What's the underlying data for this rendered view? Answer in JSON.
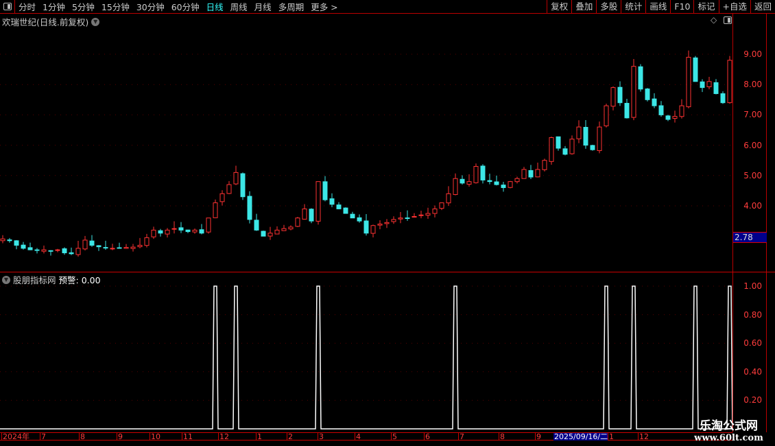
{
  "toolbar": {
    "periods": [
      {
        "label": "分时"
      },
      {
        "label": "1分钟"
      },
      {
        "label": "5分钟"
      },
      {
        "label": "15分钟"
      },
      {
        "label": "30分钟"
      },
      {
        "label": "60分钟"
      },
      {
        "label": "日线",
        "active": true
      },
      {
        "label": "周线"
      },
      {
        "label": "月线"
      },
      {
        "label": "多周期"
      },
      {
        "label": "更多 >"
      }
    ],
    "right_buttons": [
      "复权",
      "叠加",
      "多股",
      "统计",
      "画线",
      "F10",
      "标记",
      "+自选",
      "返回"
    ]
  },
  "stock_title": "欢瑞世纪(日线.前复权)",
  "indicator": {
    "name": "股朋指标网",
    "label": "预警: 0.00"
  },
  "current_price_label": "2.78",
  "watermark": {
    "line1": "乐淘公式网",
    "line2": "www.60lt.com"
  },
  "colors": {
    "up": "#ff3232",
    "down": "#3ce6e6",
    "axis": "#cc0000",
    "signal": "#ffffff"
  },
  "chart_data": [
    {
      "type": "candlestick",
      "y_ticks": [
        "9.00",
        "8.00",
        "7.00",
        "6.00",
        "5.00",
        "4.00"
      ],
      "ylim": [
        2.3,
        9.6
      ],
      "closes": [
        2.91,
        2.85,
        2.7,
        2.6,
        2.55,
        2.53,
        2.55,
        2.5,
        2.55,
        2.45,
        2.42,
        2.6,
        2.87,
        2.7,
        2.65,
        2.62,
        2.6,
        2.62,
        2.63,
        2.64,
        2.7,
        2.95,
        3.2,
        3.1,
        3.2,
        3.25,
        3.2,
        3.15,
        3.2,
        3.1,
        3.6,
        4.1,
        4.4,
        4.7,
        5.1,
        4.3,
        3.55,
        3.2,
        3.0,
        3.1,
        3.2,
        3.25,
        3.3,
        3.6,
        3.9,
        3.5,
        4.8,
        4.2,
        4.05,
        3.9,
        3.75,
        3.6,
        3.5,
        3.1,
        3.35,
        3.4,
        3.45,
        3.55,
        3.6,
        3.6,
        3.65,
        3.7,
        3.75,
        3.9,
        4.1,
        4.4,
        4.9,
        4.75,
        4.8,
        5.3,
        4.85,
        4.8,
        4.7,
        4.6,
        4.8,
        4.9,
        5.2,
        4.95,
        5.2,
        5.5,
        6.25,
        5.9,
        5.7,
        6.2,
        6.6,
        6.0,
        5.85,
        6.6,
        7.3,
        7.9,
        7.4,
        6.9,
        8.6,
        7.85,
        7.5,
        7.3,
        7.0,
        6.85,
        6.95,
        7.3,
        8.9,
        8.1,
        7.9,
        8.1,
        7.7,
        7.4,
        8.8
      ]
    },
    {
      "type": "line",
      "name": "预警",
      "y_ticks": [
        "1.00",
        "0.80",
        "0.60",
        "0.40",
        "0.20"
      ],
      "ylim": [
        0,
        1
      ],
      "signal_bars": [
        31,
        34,
        46,
        66,
        88,
        92,
        101,
        106
      ]
    }
  ],
  "time_axis": {
    "labels": [
      "2024年",
      "7",
      "8",
      "9",
      "10",
      "11",
      "12",
      "1",
      "2",
      "3",
      "4",
      "5",
      "6",
      "7",
      "8",
      "9",
      "1",
      "12"
    ],
    "highlight": "2025/09/16/二"
  }
}
